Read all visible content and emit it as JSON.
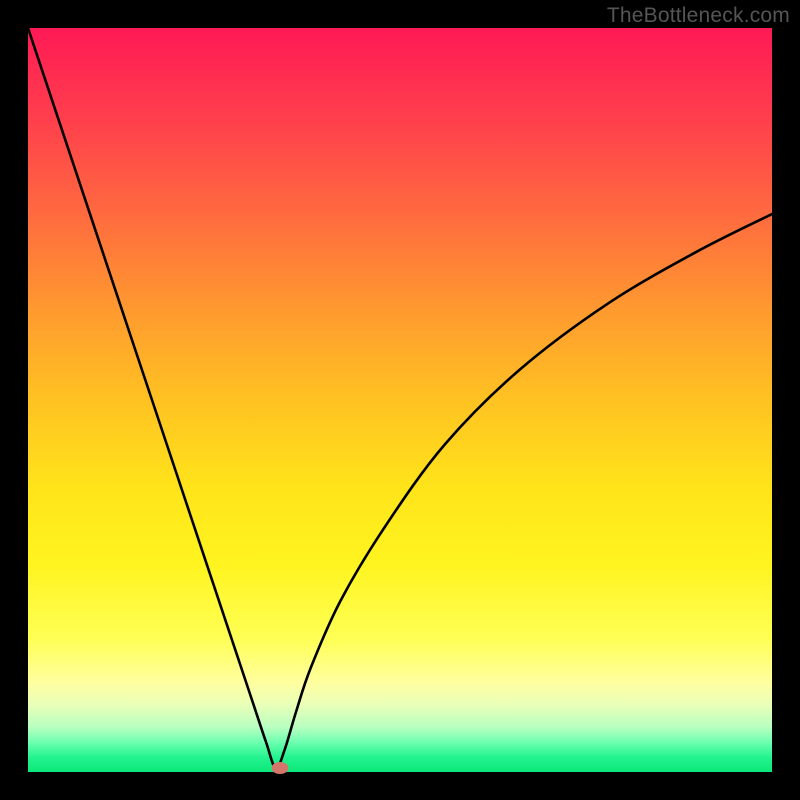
{
  "watermark": "TheBottleneck.com",
  "chart_data": {
    "type": "line",
    "title": "",
    "xlabel": "",
    "ylabel": "",
    "xlim": [
      0,
      100
    ],
    "ylim": [
      0,
      100
    ],
    "series": [
      {
        "name": "curve",
        "x": [
          0,
          4,
          8,
          12,
          16,
          20,
          24,
          28,
          30,
          32,
          33.3,
          34.5,
          36,
          38,
          42,
          48,
          56,
          66,
          78,
          90,
          100
        ],
        "y": [
          100,
          88,
          76,
          64,
          52,
          40,
          28,
          16,
          10,
          4,
          0.5,
          3,
          8,
          14,
          23,
          33,
          44,
          54,
          63,
          70,
          75
        ]
      }
    ],
    "marker": {
      "x": 33.9,
      "y": 0.5,
      "color": "#d4776a"
    },
    "background_gradient": {
      "stops": [
        {
          "pos": 0.0,
          "color": "#ff1a55"
        },
        {
          "pos": 0.5,
          "color": "#ffc222"
        },
        {
          "pos": 0.82,
          "color": "#ffff55"
        },
        {
          "pos": 1.0,
          "color": "#0ae878"
        }
      ]
    }
  }
}
